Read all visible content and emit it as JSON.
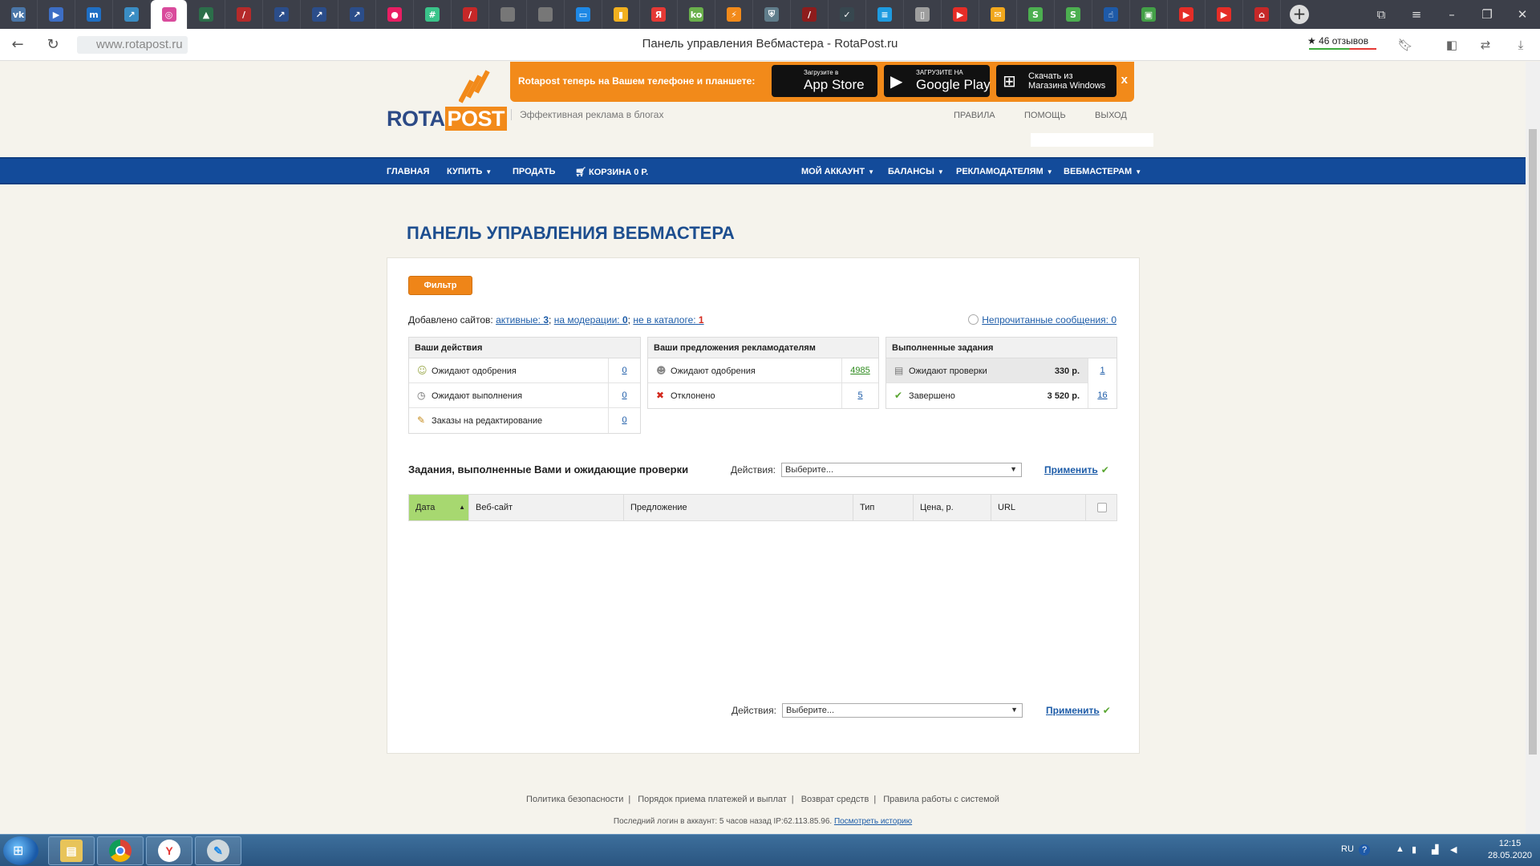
{
  "browser": {
    "tabs": [
      {
        "icon": "vk-icon",
        "glyph": "vk",
        "color": "#4a76a8",
        "active": false
      },
      {
        "icon": "play-icon",
        "glyph": "▶",
        "color": "#3d6ec5",
        "active": false
      },
      {
        "icon": "m-icon",
        "glyph": "m",
        "color": "#1f6fc4",
        "active": false
      },
      {
        "icon": "chart-icon",
        "glyph": "↗",
        "color": "#3a8dc4",
        "active": false
      },
      {
        "icon": "target-icon",
        "glyph": "◎",
        "color": "#d94b9c",
        "active": true
      },
      {
        "icon": "photo-icon",
        "glyph": "▲",
        "color": "#2c6e4a",
        "active": false
      },
      {
        "icon": "pen-icon",
        "glyph": "/",
        "color": "#b52a2a",
        "active": false
      },
      {
        "icon": "rocket-icon",
        "glyph": "↗",
        "color": "#2b4d8a",
        "active": false
      },
      {
        "icon": "rocket-icon",
        "glyph": "↗",
        "color": "#2b4d8a",
        "active": false
      },
      {
        "icon": "rocket-icon",
        "glyph": "↗",
        "color": "#2b4d8a",
        "active": false
      },
      {
        "icon": "circle-icon",
        "glyph": "●",
        "color": "#e91e63",
        "active": false
      },
      {
        "icon": "hash-icon",
        "glyph": "#",
        "color": "#3ac48a",
        "active": false
      },
      {
        "icon": "slash-icon",
        "glyph": "/",
        "color": "#c62828",
        "active": false
      },
      {
        "icon": "apple-icon",
        "glyph": "",
        "color": "#777777",
        "active": false
      },
      {
        "icon": "apple-icon",
        "glyph": "",
        "color": "#777777",
        "active": false
      },
      {
        "icon": "monitor-icon",
        "glyph": "▭",
        "color": "#1e88e5",
        "active": false
      },
      {
        "icon": "bars-icon",
        "glyph": "▮",
        "color": "#f2b01e",
        "active": false
      },
      {
        "icon": "yandex-icon",
        "glyph": "Я",
        "color": "#e53935",
        "active": false
      },
      {
        "icon": "ko-icon",
        "glyph": "ko",
        "color": "#6ab04c",
        "active": false
      },
      {
        "icon": "bolt-icon",
        "glyph": "⚡",
        "color": "#f28a1a",
        "active": false
      },
      {
        "icon": "shield-icon",
        "glyph": "⛨",
        "color": "#607d8b",
        "active": false
      },
      {
        "icon": "slash-icon",
        "glyph": "/",
        "color": "#8e1c1c",
        "active": false
      },
      {
        "icon": "check-icon",
        "glyph": "✓",
        "color": "#37474f",
        "active": false
      },
      {
        "icon": "chat-icon",
        "glyph": "≡",
        "color": "#1e9be0",
        "active": false
      },
      {
        "icon": "doc-icon",
        "glyph": "▯",
        "color": "#9e9e9e",
        "active": false
      },
      {
        "icon": "youtube-icon",
        "glyph": "▶",
        "color": "#e52d27",
        "active": false
      },
      {
        "icon": "mail-icon",
        "glyph": "✉",
        "color": "#f2a81d",
        "active": false
      },
      {
        "icon": "s-icon",
        "glyph": "S",
        "color": "#4caf50",
        "active": false
      },
      {
        "icon": "s-icon",
        "glyph": "S",
        "color": "#4caf50",
        "active": false
      },
      {
        "icon": "hand-icon",
        "glyph": "☝",
        "color": "#1e5aa8",
        "active": false
      },
      {
        "icon": "folder-icon",
        "glyph": "▣",
        "color": "#43a047",
        "active": false
      },
      {
        "icon": "youtube-icon",
        "glyph": "▶",
        "color": "#e52d27",
        "active": false
      },
      {
        "icon": "youtube-icon",
        "glyph": "▶",
        "color": "#e52d27",
        "active": false
      },
      {
        "icon": "home-icon",
        "glyph": "⌂",
        "color": "#c62828",
        "active": false
      }
    ],
    "url": "www.rotapost.ru",
    "title": "Панель управления Вебмастера - RotaPost.ru",
    "reviews": "★ 46 отзывов"
  },
  "header": {
    "logo_rota": "ROTA",
    "logo_post": "POST",
    "tagline": "Эффективная реклама в блогах",
    "promo_text": "Rotapost теперь на Вашем телефоне и планшете:",
    "appstore_small": "Загрузите в",
    "appstore_big": "App Store",
    "googleplay_small": "ЗАГРУЗИТЕ НА",
    "googleplay_big": "Google Play",
    "windows_line1": "Скачать из",
    "windows_line2": "Магазина Windows",
    "promo_close": "x",
    "links": {
      "rules": "Правила",
      "help": "Помощь",
      "logout": "Выход"
    }
  },
  "nav": {
    "home": "Главная",
    "buy": "Купить",
    "sell": "Продать",
    "cart": "Корзина 0 р.",
    "account": "Мой аккаунт",
    "balances": "Балансы",
    "advertisers": "Рекламодателям",
    "webmasters": "Вебмастерам"
  },
  "main": {
    "title": "Панель управления вебмастера",
    "filter": "Фильтр",
    "sites_prefix": "Добавлено сайтов:",
    "active_label": "активные:",
    "active_count": "3",
    "moderation_label": "на модерации:",
    "moderation_count": "0",
    "not_in_catalog_label": "не в каталоге:",
    "not_in_catalog_count": "1",
    "unread": "Непрочитанные сообщения: 0",
    "panels": {
      "actions": {
        "title": "Ваши действия",
        "rows": [
          {
            "label": "Ожидают одобрения",
            "count": "0"
          },
          {
            "label": "Ожидают выполнения",
            "count": "0"
          },
          {
            "label": "Заказы на редактирование",
            "count": "0"
          }
        ]
      },
      "offers": {
        "title": "Ваши предложения рекламодателям",
        "rows": [
          {
            "label": "Ожидают одобрения",
            "count": "4985"
          },
          {
            "label": "Отклонено",
            "count": "5"
          }
        ]
      },
      "done": {
        "title": "Выполненные задания",
        "rows": [
          {
            "label": "Ожидают проверки",
            "amount": "330 р.",
            "count": "1"
          },
          {
            "label": "Завершено",
            "amount": "3 520 р.",
            "count": "16"
          }
        ]
      }
    },
    "tasks_title": "Задания, выполненные Вами и ожидающие проверки",
    "actions_label": "Действия:",
    "select_value": "Выберите...",
    "apply": "Применить",
    "columns": [
      "Дата",
      "Веб-сайт",
      "Предложение",
      "Тип",
      "Цена, р.",
      "URL"
    ]
  },
  "footer": {
    "links": [
      "Политика безопасности",
      "Порядок приема платежей и выплат",
      "Возврат средств",
      "Правила работы с системой"
    ],
    "last_login": "Последний логин в аккаунт: 5 часов назад IP:62.113.85.96.",
    "history_link": "Посмотреть историю"
  },
  "taskbar": {
    "lang": "RU",
    "time": "12:15",
    "date": "28.05.2020"
  }
}
